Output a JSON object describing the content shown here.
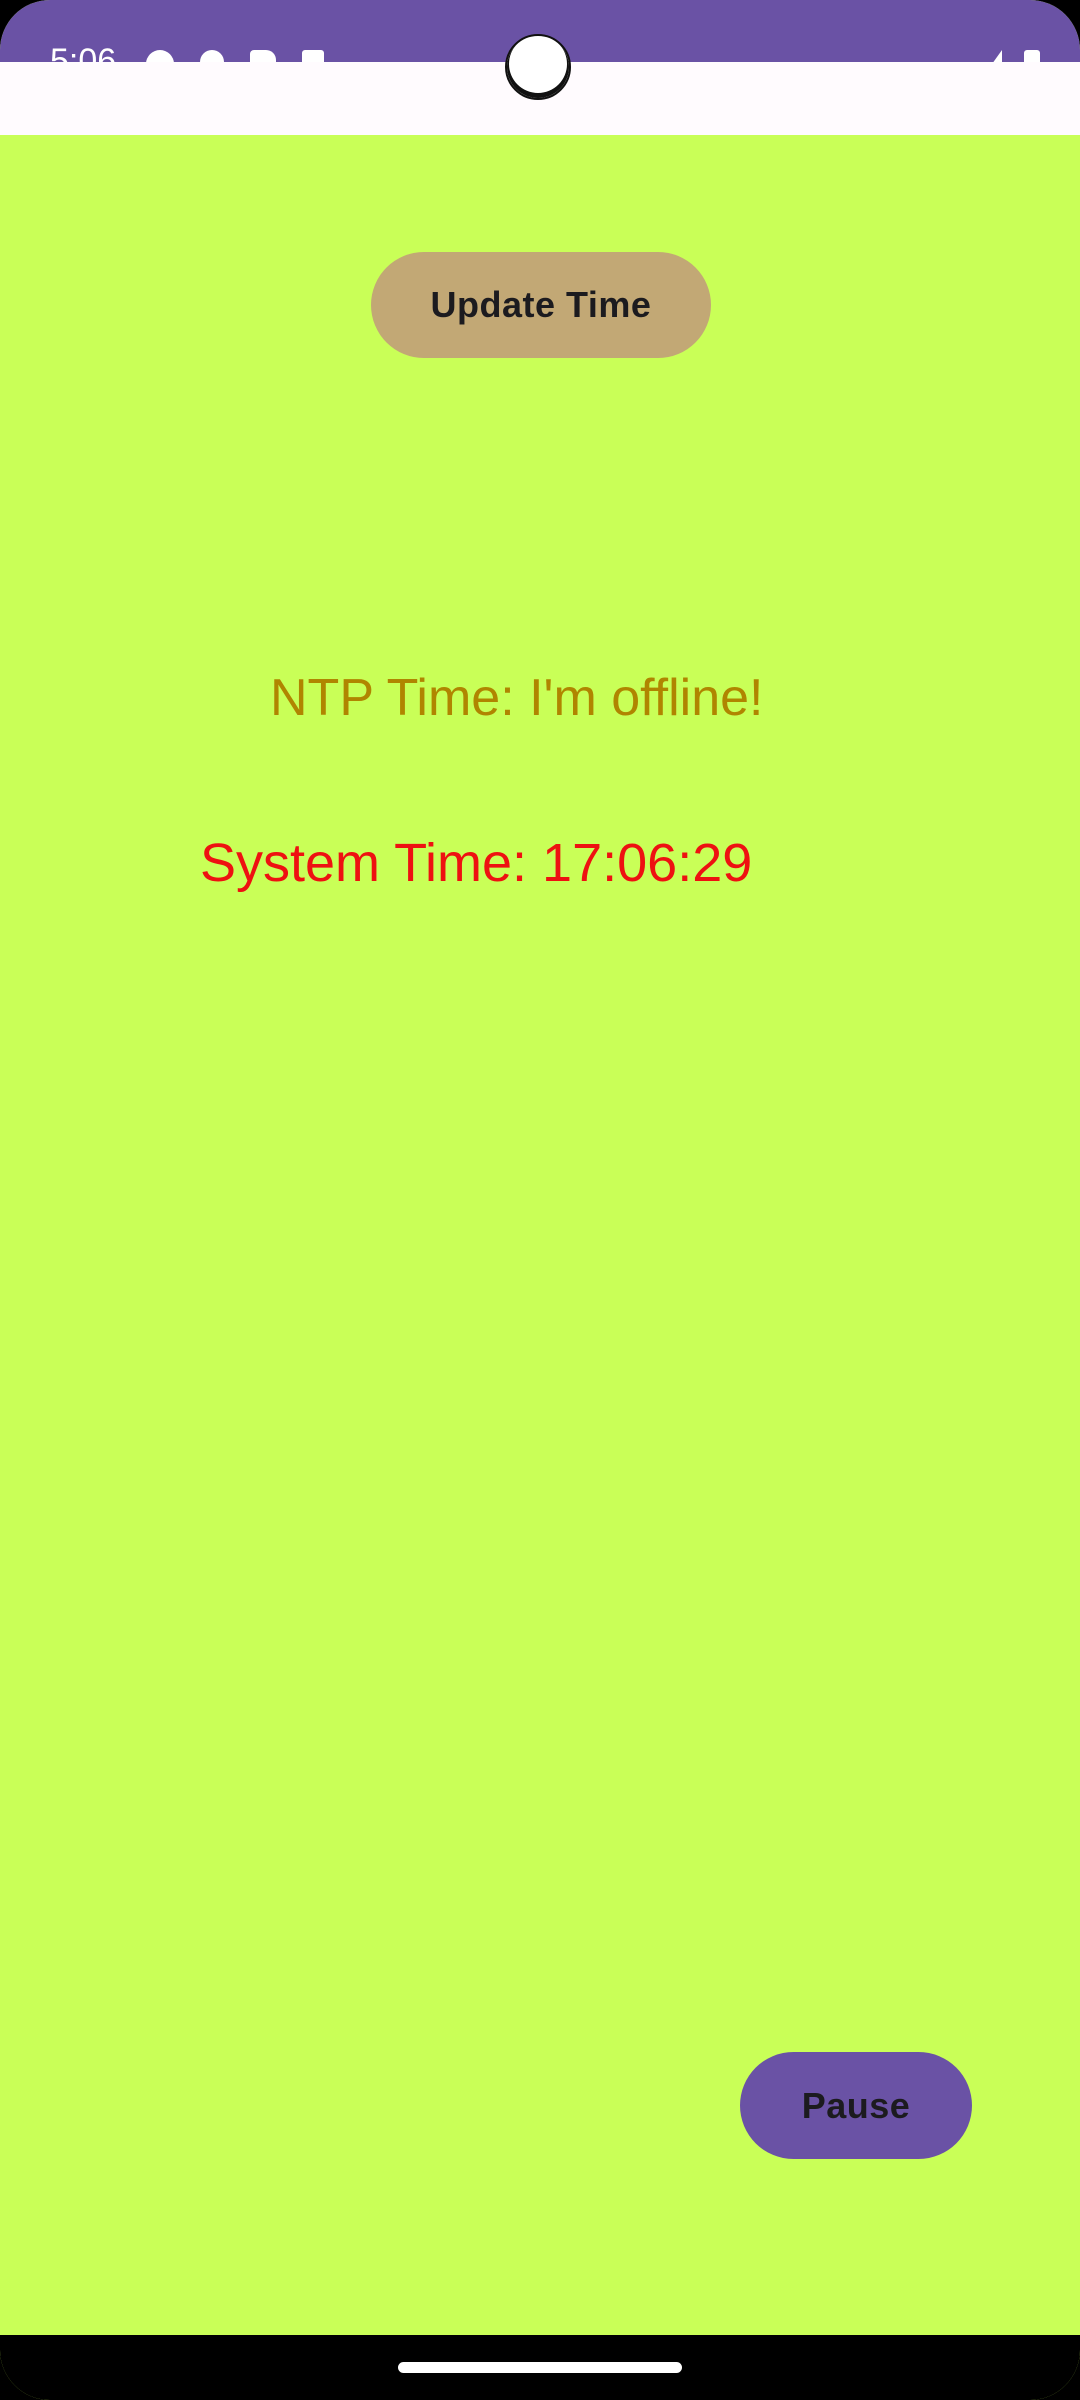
{
  "status_bar": {
    "time": "5:06",
    "left_icons": [
      "shield-icon",
      "wifi-icon",
      "sd-card-icon",
      "message-icon"
    ],
    "right_icons": [
      "signal-icon",
      "battery-icon"
    ],
    "color": "#6a52a5"
  },
  "main": {
    "update_button_label": "Update Time",
    "ntp_time_text": "NTP Time: I'm offline!",
    "system_time_text": "System Time: 17:06:29",
    "pause_button_label": "Pause",
    "background_color": "#c9ff57",
    "ntp_color": "#b08500",
    "system_time_color": "#ee1111"
  }
}
